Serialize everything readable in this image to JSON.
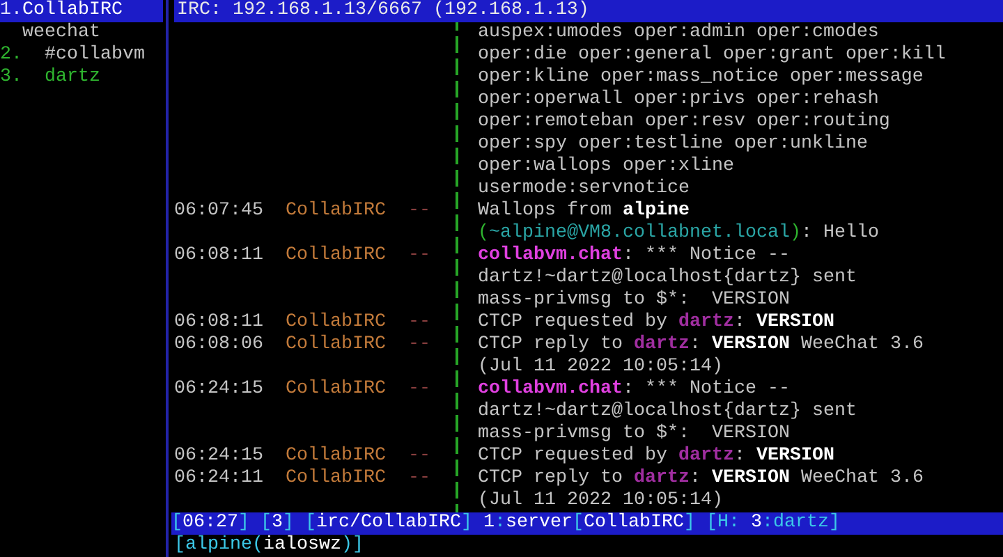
{
  "sidebar": {
    "items": [
      {
        "number": "1.",
        "label": "CollabIRC",
        "kind": "server",
        "selected": true,
        "hot": false
      },
      {
        "label": "weechat",
        "kind": "core",
        "selected": false,
        "hot": false
      },
      {
        "number": "2.",
        "label": "#collabvm",
        "kind": "channel",
        "selected": false,
        "hot": false
      },
      {
        "number": "3.",
        "label": "dartz",
        "kind": "private",
        "selected": false,
        "hot": true
      }
    ]
  },
  "title": "IRC: 192.168.1.13/6667 (192.168.1.13)",
  "chat": {
    "lines": [
      {
        "message": [
          {
            "kind": "plain",
            "text": "auspex:umodes oper:admin oper:cmodes"
          }
        ]
      },
      {
        "message": [
          {
            "kind": "plain",
            "text": "oper:die oper:general oper:grant oper:kill"
          }
        ]
      },
      {
        "message": [
          {
            "kind": "plain",
            "text": "oper:kline oper:mass_notice oper:message"
          }
        ]
      },
      {
        "message": [
          {
            "kind": "plain",
            "text": "oper:operwall oper:privs oper:rehash"
          }
        ]
      },
      {
        "message": [
          {
            "kind": "plain",
            "text": "oper:remoteban oper:resv oper:routing"
          }
        ]
      },
      {
        "message": [
          {
            "kind": "plain",
            "text": "oper:spy oper:testline oper:unkline"
          }
        ]
      },
      {
        "message": [
          {
            "kind": "plain",
            "text": "oper:wallops oper:xline"
          }
        ]
      },
      {
        "message": [
          {
            "kind": "plain",
            "text": "usermode:servnotice"
          }
        ]
      },
      {
        "time": "06:07:45",
        "nick": "CollabIRC",
        "arrow": "--",
        "message": [
          {
            "kind": "plain",
            "text": "Wallops from "
          },
          {
            "kind": "bold",
            "text": "alpine"
          }
        ]
      },
      {
        "message": [
          {
            "kind": "paren",
            "text": "("
          },
          {
            "kind": "host",
            "text": "~alpine@VM8.collabnet.local"
          },
          {
            "kind": "paren",
            "text": ")"
          },
          {
            "kind": "plain",
            "text": ": Hello"
          }
        ]
      },
      {
        "time": "06:08:11",
        "nick": "CollabIRC",
        "arrow": "--",
        "message": [
          {
            "kind": "server",
            "text": "collabvm.chat"
          },
          {
            "kind": "plain",
            "text": ": *** Notice --"
          }
        ]
      },
      {
        "message": [
          {
            "kind": "plain",
            "text": "dartz!~dartz@localhost{dartz} sent"
          }
        ]
      },
      {
        "message": [
          {
            "kind": "plain",
            "text": "mass-privmsg to $*:  VERSION"
          }
        ]
      },
      {
        "time": "06:08:11",
        "nick": "CollabIRC",
        "arrow": "--",
        "message": [
          {
            "kind": "plain",
            "text": "CTCP requested by "
          },
          {
            "kind": "nick",
            "text": "dartz"
          },
          {
            "kind": "plain",
            "text": ": "
          },
          {
            "kind": "bold",
            "text": "VERSION"
          }
        ]
      },
      {
        "time": "06:08:06",
        "nick": "CollabIRC",
        "arrow": "--",
        "message": [
          {
            "kind": "plain",
            "text": "CTCP reply to "
          },
          {
            "kind": "nick",
            "text": "dartz"
          },
          {
            "kind": "plain",
            "text": ": "
          },
          {
            "kind": "bold",
            "text": "VERSION"
          },
          {
            "kind": "plain",
            "text": " WeeChat 3.6"
          }
        ]
      },
      {
        "message": [
          {
            "kind": "plain",
            "text": "(Jul 11 2022 10:05:14)"
          }
        ]
      },
      {
        "time": "06:24:15",
        "nick": "CollabIRC",
        "arrow": "--",
        "message": [
          {
            "kind": "server",
            "text": "collabvm.chat"
          },
          {
            "kind": "plain",
            "text": ": *** Notice --"
          }
        ]
      },
      {
        "message": [
          {
            "kind": "plain",
            "text": "dartz!~dartz@localhost{dartz} sent"
          }
        ]
      },
      {
        "message": [
          {
            "kind": "plain",
            "text": "mass-privmsg to $*:  VERSION"
          }
        ]
      },
      {
        "time": "06:24:15",
        "nick": "CollabIRC",
        "arrow": "--",
        "message": [
          {
            "kind": "plain",
            "text": "CTCP requested by "
          },
          {
            "kind": "nick",
            "text": "dartz"
          },
          {
            "kind": "plain",
            "text": ": "
          },
          {
            "kind": "bold",
            "text": "VERSION"
          }
        ]
      },
      {
        "time": "06:24:11",
        "nick": "CollabIRC",
        "arrow": "--",
        "message": [
          {
            "kind": "plain",
            "text": "CTCP reply to "
          },
          {
            "kind": "nick",
            "text": "dartz"
          },
          {
            "kind": "plain",
            "text": ": "
          },
          {
            "kind": "bold",
            "text": "VERSION"
          },
          {
            "kind": "plain",
            "text": " WeeChat 3.6"
          }
        ]
      },
      {
        "message": [
          {
            "kind": "plain",
            "text": "(Jul 11 2022 10:05:14)"
          }
        ]
      }
    ]
  },
  "status_bar": [
    {
      "kind": "delim",
      "text": "["
    },
    {
      "kind": "text",
      "text": "06:27"
    },
    {
      "kind": "delim",
      "text": "] ["
    },
    {
      "kind": "text",
      "text": "3"
    },
    {
      "kind": "delim",
      "text": "] ["
    },
    {
      "kind": "text",
      "text": "irc/CollabIRC"
    },
    {
      "kind": "delim",
      "text": "] "
    },
    {
      "kind": "text",
      "text": "1"
    },
    {
      "kind": "delim",
      "text": ":"
    },
    {
      "kind": "text",
      "text": "server"
    },
    {
      "kind": "delim",
      "text": "["
    },
    {
      "kind": "text",
      "text": "CollabIRC"
    },
    {
      "kind": "delim",
      "text": "] [H: "
    },
    {
      "kind": "text",
      "text": "3"
    },
    {
      "kind": "delim",
      "text": ":dartz]"
    }
  ],
  "input_prompt": [
    {
      "kind": "delim",
      "text": "[alpine("
    },
    {
      "kind": "text",
      "text": "ialoswz"
    },
    {
      "kind": "delim",
      "text": ")]"
    }
  ]
}
